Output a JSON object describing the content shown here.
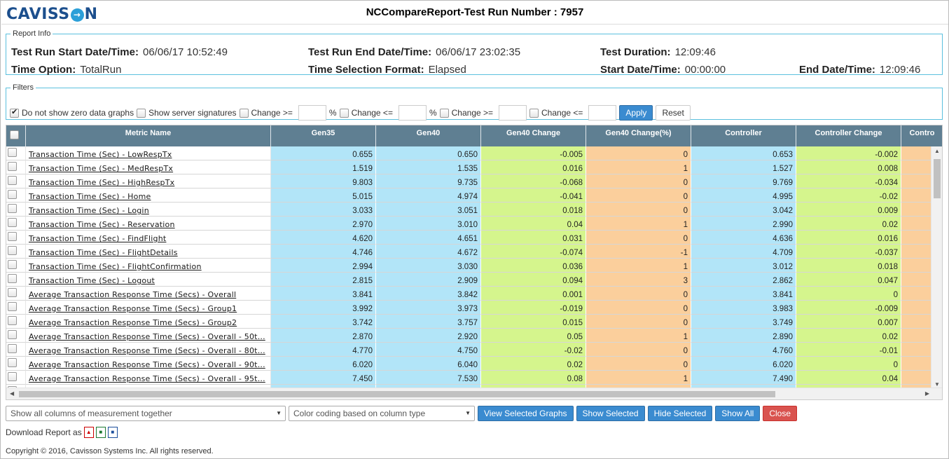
{
  "header": {
    "logo_left": "CAVISS",
    "logo_ring": "→",
    "logo_right": "N",
    "title": "NCCompareReport-Test Run Number : 7957"
  },
  "report_info": {
    "legend": "Report Info",
    "start_label": "Test Run Start Date/Time:",
    "start_value": "06/06/17 10:52:49",
    "end_label": "Test Run End Date/Time:",
    "end_value": "06/06/17 23:02:35",
    "duration_label": "Test Duration:",
    "duration_value": "12:09:46",
    "time_option_label": "Time Option:",
    "time_option_value": "TotalRun",
    "format_label": "Time Selection Format:",
    "format_value": "Elapsed",
    "start_dt_label": "Start Date/Time:",
    "start_dt_value": "00:00:00",
    "end_dt_label": "End Date/Time:",
    "end_dt_value": "12:09:46"
  },
  "filters": {
    "legend": "Filters",
    "zero_label": "Do not show zero data graphs",
    "zero_checked": true,
    "sig_label": "Show server signatures",
    "change_ge_label": "Change >=",
    "change_le_label": "Change <=",
    "percent": "%",
    "apply": "Apply",
    "reset": "Reset"
  },
  "grid": {
    "headers": [
      "Metric Name",
      "Gen35",
      "Gen40",
      "Gen40 Change",
      "Gen40 Change(%)",
      "Controller",
      "Controller Change",
      "Contro"
    ],
    "rows": [
      [
        "Transaction Time (Sec) - LowRespTx",
        "0.655",
        "0.650",
        "-0.005",
        "0",
        "0.653",
        "-0.002"
      ],
      [
        "Transaction Time (Sec) - MedRespTx",
        "1.519",
        "1.535",
        "0.016",
        "1",
        "1.527",
        "0.008"
      ],
      [
        "Transaction Time (Sec) - HighRespTx",
        "9.803",
        "9.735",
        "-0.068",
        "0",
        "9.769",
        "-0.034"
      ],
      [
        "Transaction Time (Sec) - Home",
        "5.015",
        "4.974",
        "-0.041",
        "0",
        "4.995",
        "-0.02"
      ],
      [
        "Transaction Time (Sec) - Login",
        "3.033",
        "3.051",
        "0.018",
        "0",
        "3.042",
        "0.009"
      ],
      [
        "Transaction Time (Sec) - Reservation",
        "2.970",
        "3.010",
        "0.04",
        "1",
        "2.990",
        "0.02"
      ],
      [
        "Transaction Time (Sec) - FindFlight",
        "4.620",
        "4.651",
        "0.031",
        "0",
        "4.636",
        "0.016"
      ],
      [
        "Transaction Time (Sec) - FlightDetails",
        "4.746",
        "4.672",
        "-0.074",
        "-1",
        "4.709",
        "-0.037"
      ],
      [
        "Transaction Time (Sec) - FlightConfirmation",
        "2.994",
        "3.030",
        "0.036",
        "1",
        "3.012",
        "0.018"
      ],
      [
        "Transaction Time (Sec) - Logout",
        "2.815",
        "2.909",
        "0.094",
        "3",
        "2.862",
        "0.047"
      ],
      [
        "Average Transaction Response Time (Secs) - Overall",
        "3.841",
        "3.842",
        "0.001",
        "0",
        "3.841",
        "0"
      ],
      [
        "Average Transaction Response Time (Secs) - Group1",
        "3.992",
        "3.973",
        "-0.019",
        "0",
        "3.983",
        "-0.009"
      ],
      [
        "Average Transaction Response Time (Secs) - Group2",
        "3.742",
        "3.757",
        "0.015",
        "0",
        "3.749",
        "0.007"
      ],
      [
        "Average Transaction Response Time (Secs) - Overall - 50t...",
        "2.870",
        "2.920",
        "0.05",
        "1",
        "2.890",
        "0.02"
      ],
      [
        "Average Transaction Response Time (Secs) - Overall - 80t...",
        "4.770",
        "4.750",
        "-0.02",
        "0",
        "4.760",
        "-0.01"
      ],
      [
        "Average Transaction Response Time (Secs) - Overall - 90t...",
        "6.020",
        "6.040",
        "0.02",
        "0",
        "6.020",
        "0"
      ],
      [
        "Average Transaction Response Time (Secs) - Overall - 95t...",
        "7.450",
        "7.530",
        "0.08",
        "1",
        "7.490",
        "0.04"
      ],
      [
        "",
        "",
        "",
        "",
        "",
        "",
        ""
      ]
    ]
  },
  "bottom": {
    "measure_select": "Show all columns of measurement together",
    "color_select": "Color coding based on column type",
    "view_selected_graphs": "View Selected Graphs",
    "show_selected": "Show Selected",
    "hide_selected": "Hide Selected",
    "show_all": "Show All",
    "close": "Close",
    "download_label": "Download Report as",
    "copyright": "Copyright © 2016, Cavisson Systems Inc. All rights reserved."
  }
}
